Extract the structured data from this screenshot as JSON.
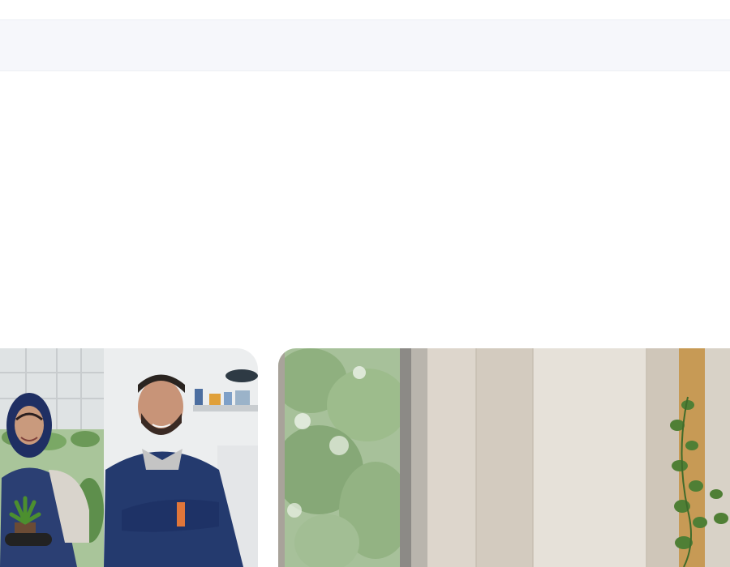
{
  "page": {
    "background_color": "#ffffff"
  },
  "search_band": {
    "background_color": "#f6f7fb"
  },
  "cards": [
    {
      "name": "greenhouse-team-photo",
      "description_icon": "photo-two-workers-greenhouse"
    },
    {
      "name": "interior-window-plant-photo",
      "description_icon": "photo-interior-curtains-plant"
    }
  ]
}
